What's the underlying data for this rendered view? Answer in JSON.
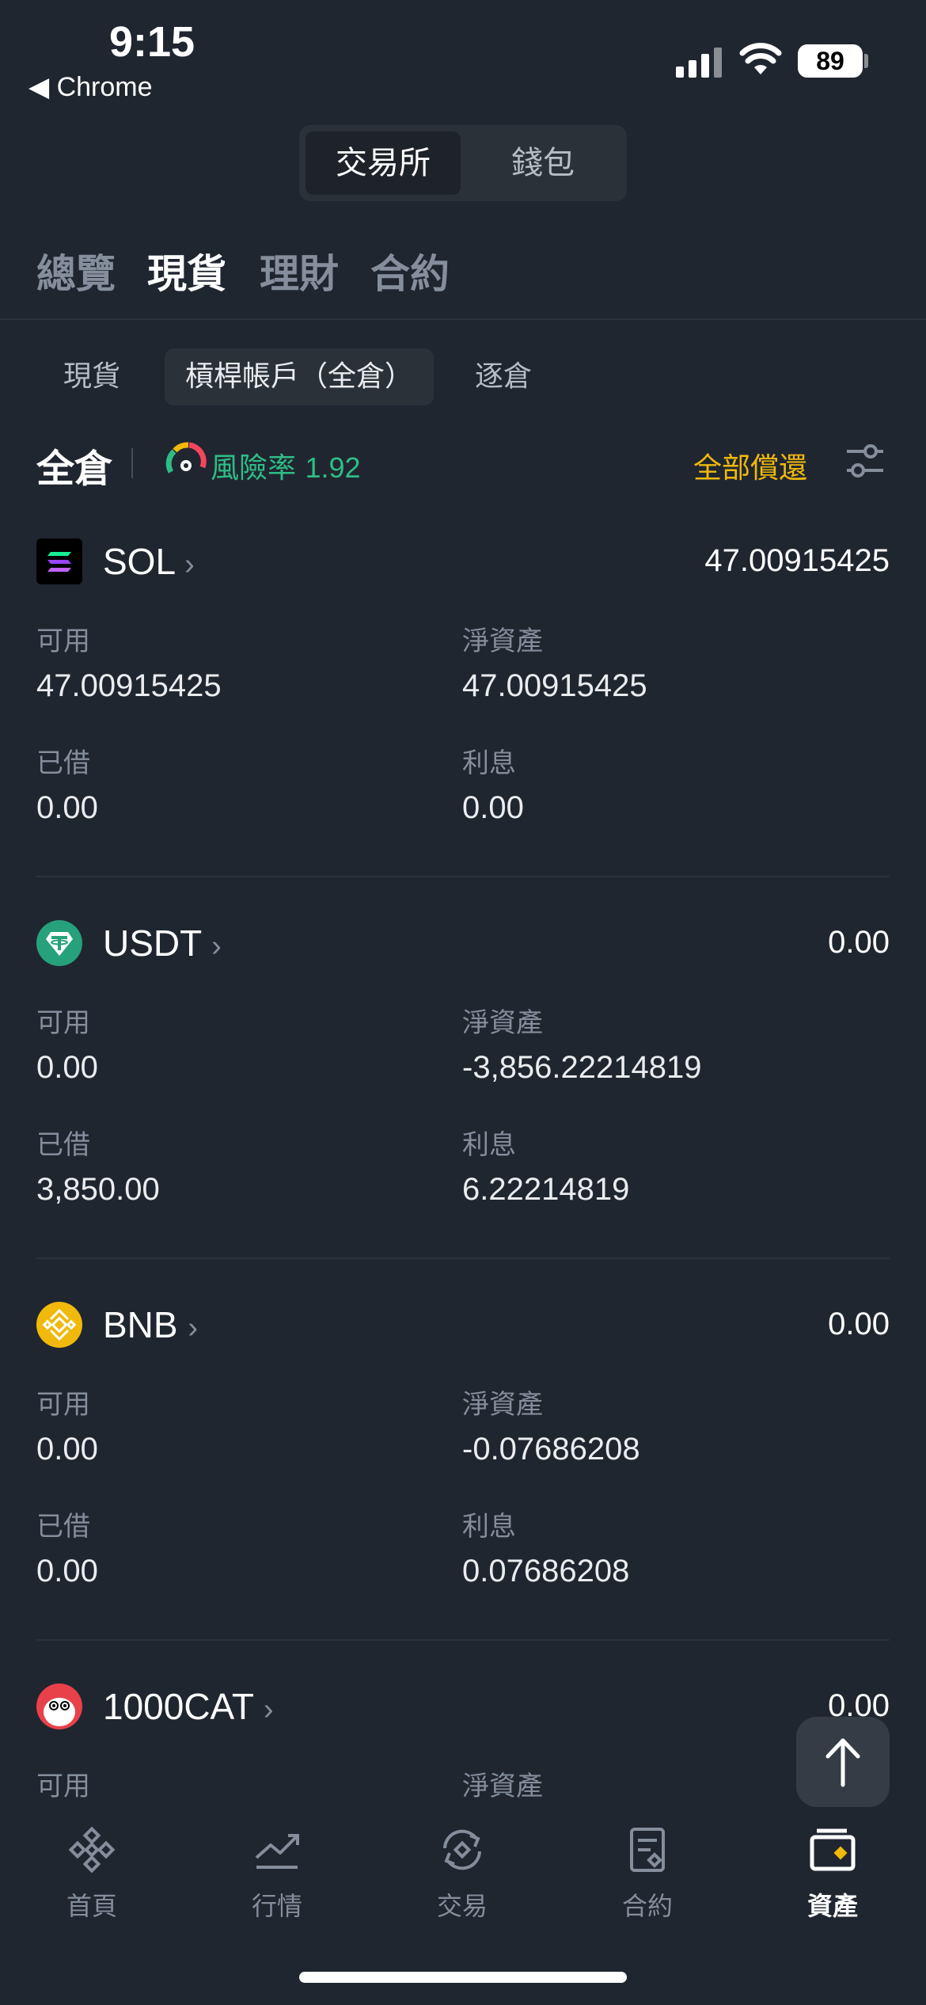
{
  "status_bar": {
    "time": "9:15",
    "back_app": "◀ Chrome",
    "battery": "89"
  },
  "top_segment": {
    "active": "交易所",
    "inactive": "錢包"
  },
  "main_tabs": [
    "總覽",
    "現貨",
    "理財",
    "合約"
  ],
  "sub_tabs": [
    "現貨",
    "槓桿帳戶（全倉）",
    "逐倉"
  ],
  "header": {
    "title": "全倉",
    "risk_label": "風險率",
    "risk_value": "1.92",
    "repay_all": "全部償還"
  },
  "labels": {
    "available": "可用",
    "net_asset": "淨資產",
    "borrowed": "已借",
    "interest": "利息"
  },
  "assets": [
    {
      "name": "SOL",
      "total": "47.00915425",
      "available": "47.00915425",
      "net_asset": "47.00915425",
      "borrowed": "0.00",
      "interest": "0.00"
    },
    {
      "name": "USDT",
      "total": "0.00",
      "available": "0.00",
      "net_asset": "-3,856.22214819",
      "borrowed": "3,850.00",
      "interest": "6.22214819"
    },
    {
      "name": "BNB",
      "total": "0.00",
      "available": "0.00",
      "net_asset": "-0.07686208",
      "borrowed": "0.00",
      "interest": "0.07686208"
    },
    {
      "name": "1000CAT",
      "total": "0.00"
    }
  ],
  "bottom_nav": [
    {
      "label": "首頁",
      "icon": "home-icon"
    },
    {
      "label": "行情",
      "icon": "markets-icon"
    },
    {
      "label": "交易",
      "icon": "trade-icon"
    },
    {
      "label": "合約",
      "icon": "futures-icon"
    },
    {
      "label": "資產",
      "icon": "wallet-icon",
      "active": true
    }
  ],
  "colors": {
    "background": "#202630",
    "accent": "#f0b90b",
    "positive": "#2ebd85",
    "muted": "#848e9c"
  }
}
